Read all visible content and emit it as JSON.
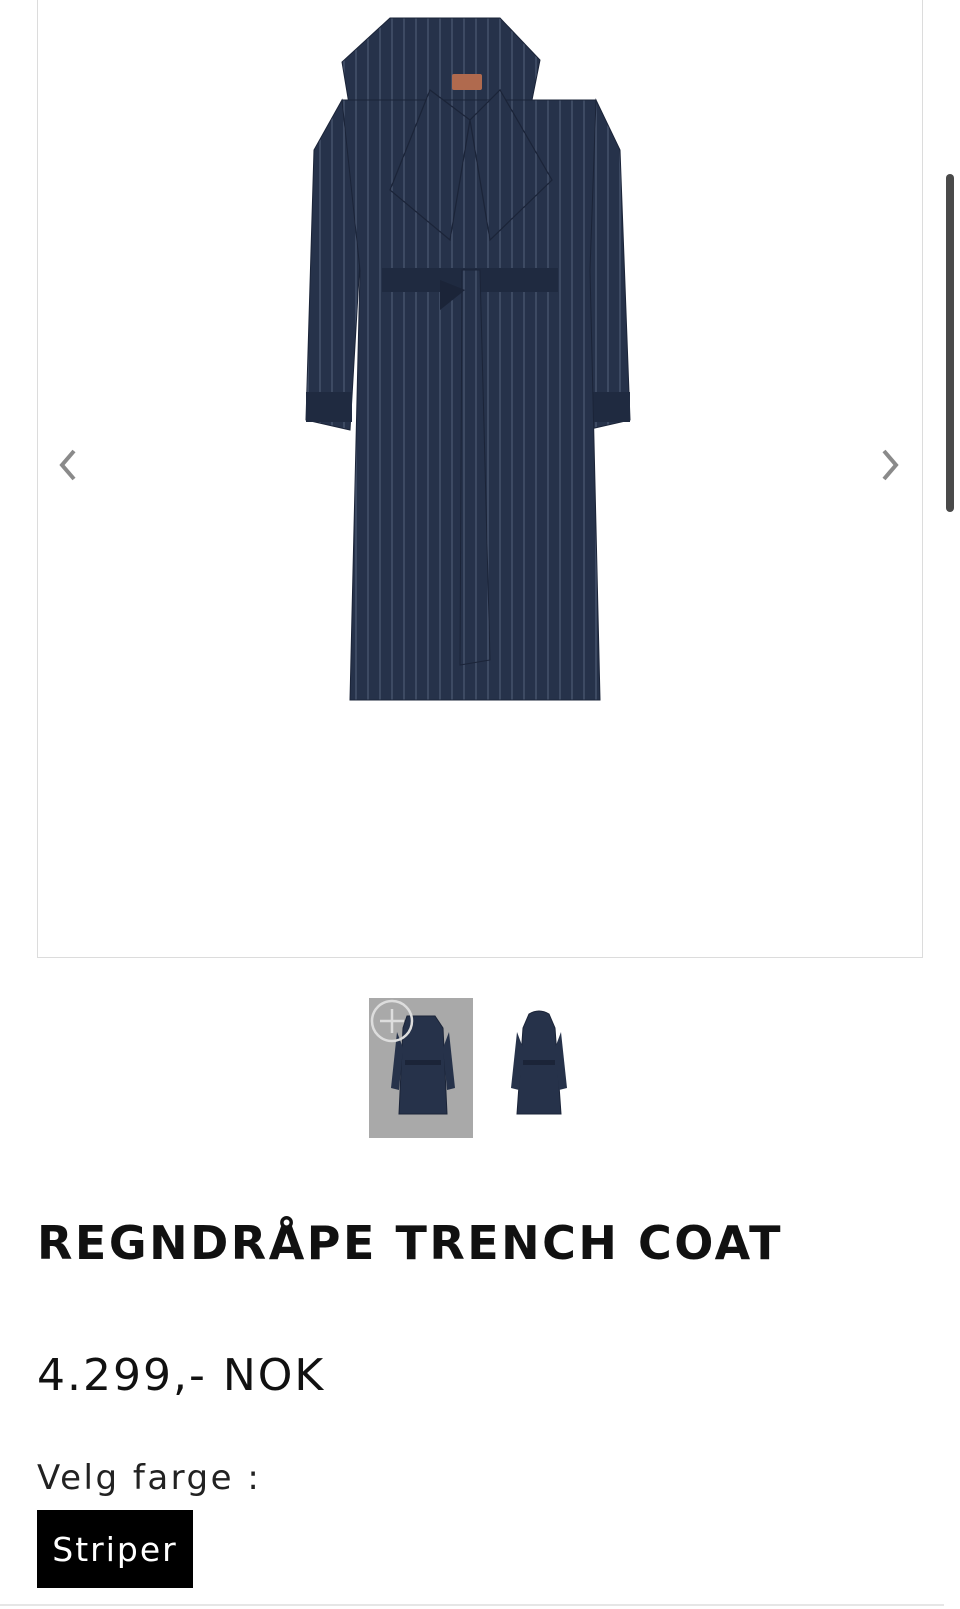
{
  "gallery": {
    "prev_icon": "chevron-left-icon",
    "next_icon": "chevron-right-icon",
    "main_image": "navy pinstripe trench coat",
    "thumbnails": [
      {
        "image": "navy pinstripe trench coat front",
        "active": true,
        "icon": "zoom-plus-icon"
      },
      {
        "image": "navy pinstripe trench coat with hood",
        "active": false
      }
    ]
  },
  "product": {
    "title": "REGNDRÅPE TRENCH COAT",
    "price": "4.299,- NOK",
    "color_label": "Velg farge :",
    "color_options": [
      "Striper"
    ],
    "selected_color": "Striper"
  },
  "colors": {
    "coat": "#26324a",
    "coat_dark": "#1b2438",
    "stripe": "#6f7c96",
    "thumb_active_bg": "#a9a9a9",
    "swatch_bg": "#000000"
  }
}
